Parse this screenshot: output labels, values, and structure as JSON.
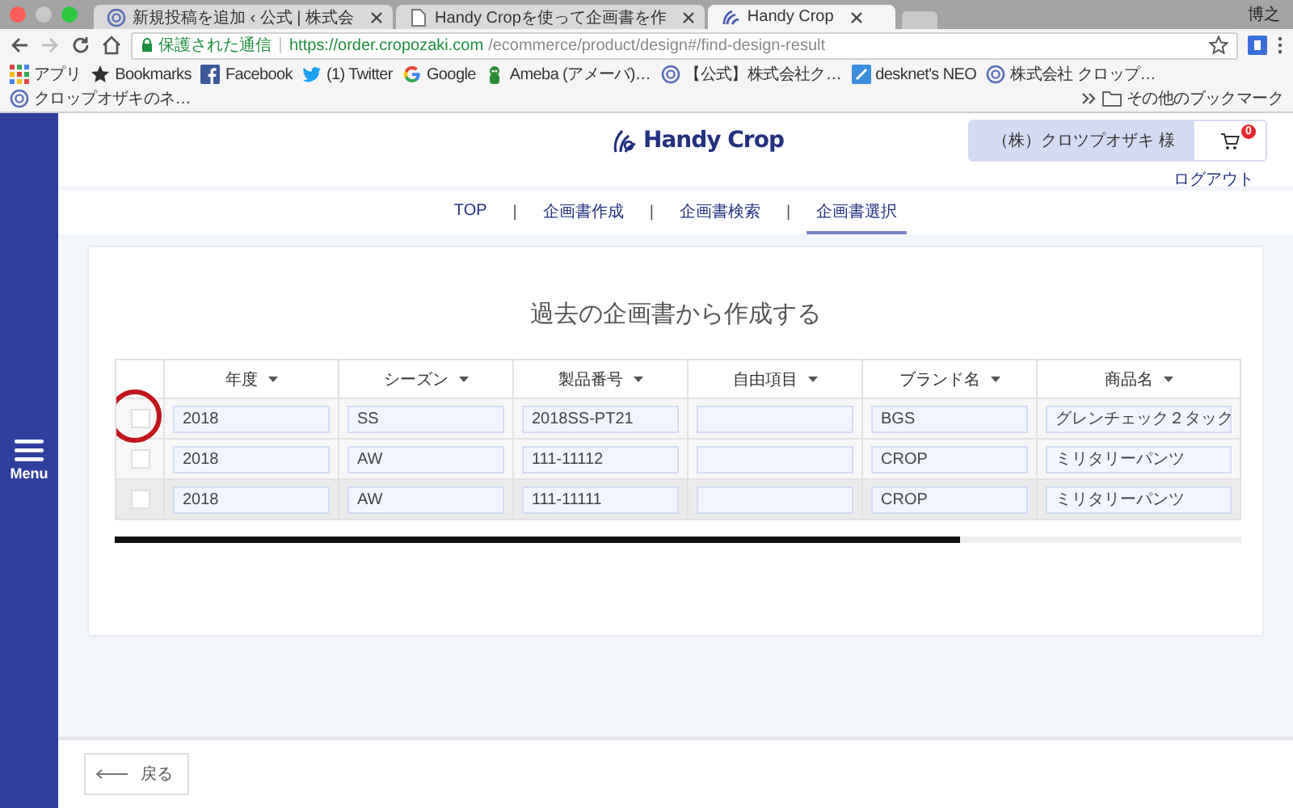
{
  "browser": {
    "tabs": [
      {
        "title": "新規投稿を追加 ‹ 公式 | 株式会",
        "selected": false
      },
      {
        "title": "Handy Cropを使って企画書を作",
        "selected": false
      },
      {
        "title": "Handy Crop",
        "selected": true
      }
    ],
    "profile": "博之",
    "address": {
      "security": "保護された通信",
      "host": "https://order.cropozaki.com",
      "path": "/ecommerce/product/design#/find-design-result"
    },
    "bookmarks": [
      "アプリ",
      "Bookmarks",
      "Facebook",
      "(1) Twitter",
      "Google",
      "Ameba (アメーバ)…",
      "【公式】株式会社ク…",
      "desknet's NEO",
      "株式会社 クロップ…",
      "クロップオザキのネ…"
    ],
    "other_bookmarks": "その他のブックマーク"
  },
  "sidebar": {
    "menu_label": "Menu"
  },
  "header": {
    "logo": "Handy Crop",
    "user": "（株）クロツプオザキ 様",
    "cart_count": "0",
    "logout": "ログアウト"
  },
  "nav": [
    {
      "label": "TOP",
      "selected": false
    },
    {
      "label": "企画書作成",
      "selected": false
    },
    {
      "label": "企画書検索",
      "selected": false
    },
    {
      "label": "企画書選択",
      "selected": true
    }
  ],
  "nav_separators": [
    "|",
    "|",
    "|"
  ],
  "page_title": "過去の企画書から作成する",
  "table": {
    "columns": [
      "年度",
      "シーズン",
      "製品番号",
      "自由項目",
      "ブランド名",
      "商品名"
    ],
    "rows": [
      {
        "checked": false,
        "circled": true,
        "highlighted": false,
        "cells": [
          "2018",
          "SS",
          "2018SS-PT21",
          "",
          "BGS",
          "グレンチェック２タック"
        ]
      },
      {
        "checked": false,
        "circled": false,
        "highlighted": false,
        "cells": [
          "2018",
          "AW",
          "111-11112",
          "",
          "CROP",
          "ミリタリーパンツ"
        ]
      },
      {
        "checked": false,
        "circled": false,
        "highlighted": true,
        "cells": [
          "2018",
          "AW",
          "111-11111",
          "",
          "CROP",
          "ミリタリーパンツ"
        ]
      }
    ]
  },
  "back_button": "戻る"
}
